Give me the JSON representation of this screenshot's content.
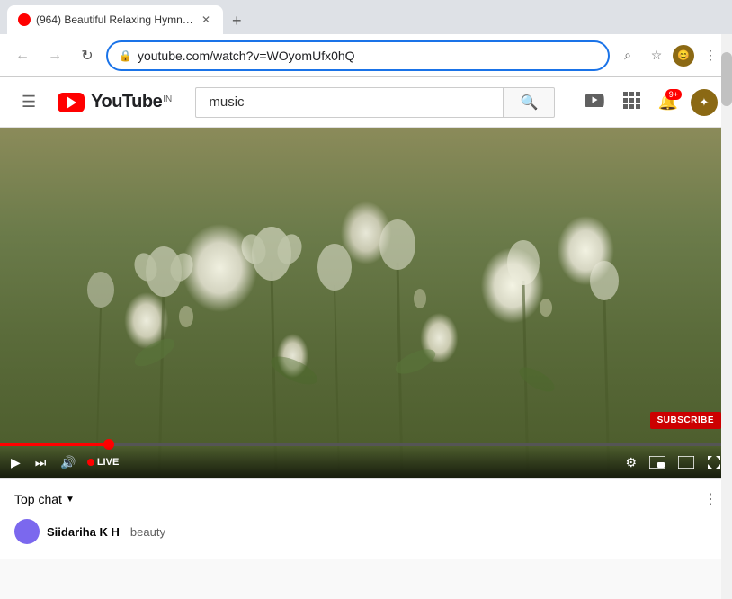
{
  "browser": {
    "tab": {
      "title": "(964) Beautiful Relaxing Hymns...",
      "favicon_color": "#ff0000"
    },
    "new_tab_label": "+",
    "address": {
      "url": "youtube.com/watch?v=WOyomUfx0hQ",
      "lock_icon": "🔒"
    },
    "nav": {
      "back": "←",
      "forward": "→",
      "refresh": "↻"
    },
    "right_icons": {
      "search": "⌕",
      "bookmark": "☆",
      "menu": "⋮"
    }
  },
  "youtube": {
    "logo_text": "YouTube",
    "country": "IN",
    "search_placeholder": "music",
    "header_icons": {
      "upload": "📹",
      "apps": "⊞",
      "notification_count": "9+",
      "avatar_letter": "✦"
    },
    "video": {
      "subscribe_label": "SUBSCRIBE",
      "live_label": "LIVE",
      "controls": {
        "play": "▶",
        "skip": "⏭",
        "volume": "🔊",
        "settings": "⚙",
        "miniplayer": "⊡",
        "theater": "⊟",
        "fullscreen": "⛶"
      }
    },
    "chat": {
      "title": "Top chat",
      "chevron": "▼",
      "more_icon": "⋮",
      "item": {
        "username": "Siidariha K H",
        "message": "beauty"
      }
    }
  }
}
